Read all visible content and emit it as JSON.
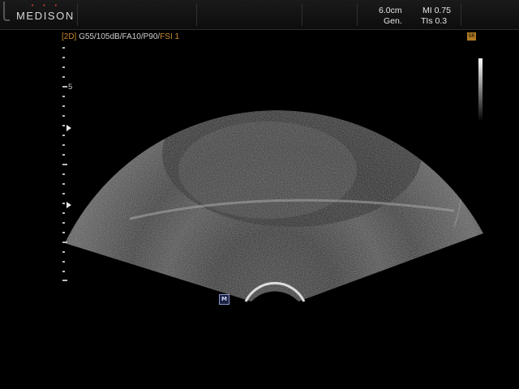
{
  "header": {
    "logo": "MEDISON",
    "logo_dots": "• • •",
    "depth": "6.0cm",
    "preset": "Gen.",
    "mi": "MI 0.75",
    "tis": "TIs 0.3"
  },
  "params": {
    "mode_tag": "[2D]",
    "settings": " G55/105dB/FA10/P90/",
    "fsi": "FSI 1"
  },
  "scale": {
    "label": "5"
  },
  "markers": {
    "orientation": "M"
  }
}
